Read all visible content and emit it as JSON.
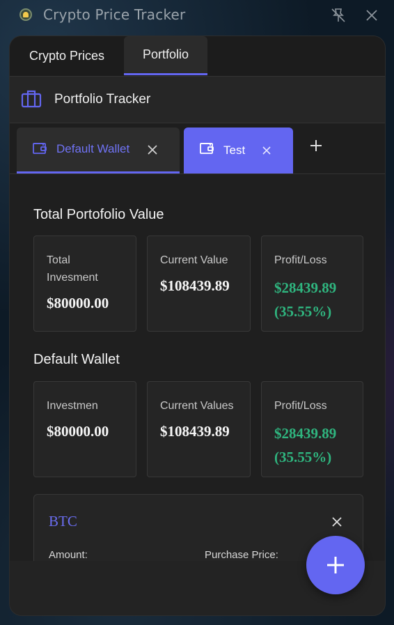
{
  "window": {
    "title": "Crypto Price Tracker",
    "icons": {
      "app": "bell-icon",
      "pin": "unpin-icon",
      "close": "close-icon"
    }
  },
  "tabs": [
    {
      "label": "Crypto Prices"
    },
    {
      "label": "Portfolio",
      "active": true
    }
  ],
  "header": {
    "title": "Portfolio Tracker",
    "icon": "briefcase-icon"
  },
  "wallet_tabs": [
    {
      "label": "Default Wallet",
      "active": true,
      "icon": "wallet-icon"
    },
    {
      "label": "Test",
      "highlighted": true,
      "icon": "wallet-icon"
    }
  ],
  "total": {
    "title": "Total Portofolio Value",
    "cards": [
      {
        "label": "Total Invesment",
        "value": "$80000.00"
      },
      {
        "label": "Current Value",
        "value": "$108439.89"
      },
      {
        "label": "Profit/Loss",
        "value": "$28439.89 (35.55%)"
      }
    ]
  },
  "wallet": {
    "title": "Default Wallet",
    "cards": [
      {
        "label": "Investmen",
        "value": "$80000.00"
      },
      {
        "label": "Current Values",
        "value": "$108439.89"
      },
      {
        "label": "Profit/Loss",
        "value": "$28439.89 (35.55%)"
      }
    ]
  },
  "coins": [
    {
      "symbol": "BTC",
      "amount_label": "Amount:",
      "purchase_label": "Purchase Price:"
    }
  ],
  "colors": {
    "accent": "#6366f1",
    "profit": "#2fb57f",
    "panel_bg": "#232323"
  }
}
